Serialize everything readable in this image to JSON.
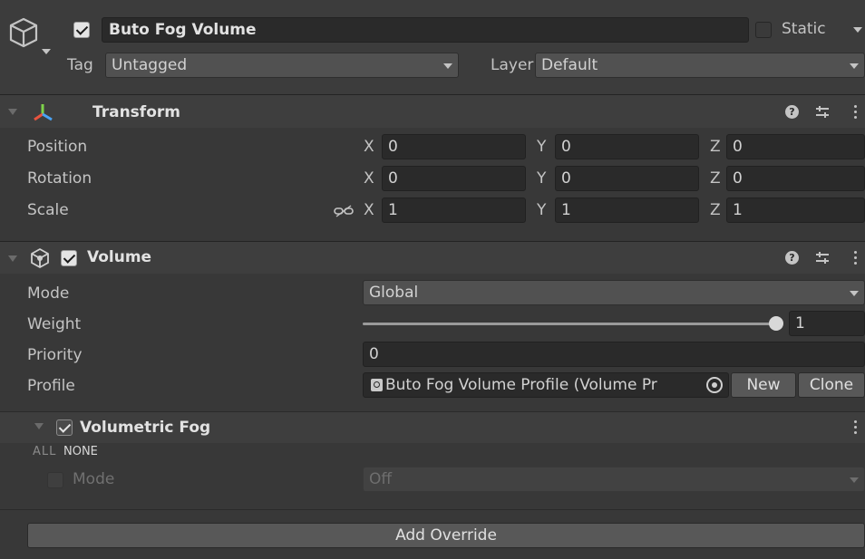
{
  "object": {
    "name": "Buto Fog Volume",
    "active": true,
    "static_label": "Static",
    "static": false,
    "tag_label": "Tag",
    "tag_value": "Untagged",
    "layer_label": "Layer",
    "layer_value": "Default"
  },
  "transform": {
    "title": "Transform",
    "rows": [
      {
        "label": "Position",
        "x": "0",
        "y": "0",
        "z": "0"
      },
      {
        "label": "Rotation",
        "x": "0",
        "y": "0",
        "z": "0"
      },
      {
        "label": "Scale",
        "x": "1",
        "y": "1",
        "z": "1"
      }
    ],
    "axis_x": "X",
    "axis_y": "Y",
    "axis_z": "Z"
  },
  "volume": {
    "title": "Volume",
    "enabled": true,
    "mode_label": "Mode",
    "mode_value": "Global",
    "weight_label": "Weight",
    "weight_value": "1",
    "weight_fraction": 1.0,
    "priority_label": "Priority",
    "priority_value": "0",
    "profile_label": "Profile",
    "profile_value": "Buto Fog Volume Profile (Volume Pr",
    "new_button": "New",
    "clone_button": "Clone"
  },
  "volumetric_fog": {
    "title": "Volumetric Fog",
    "enabled": true,
    "all_label": "ALL",
    "none_label": "NONE",
    "mode_label": "Mode",
    "mode_value": "Off",
    "mode_override": false
  },
  "add_override_button": "Add Override",
  "colors": {
    "background": "#383838",
    "field": "#2a2a2a",
    "header": "#3e3e3e",
    "transform_icon_red": "#e8543f",
    "transform_icon_green": "#7fd34b",
    "transform_icon_blue": "#4aa3f5"
  }
}
